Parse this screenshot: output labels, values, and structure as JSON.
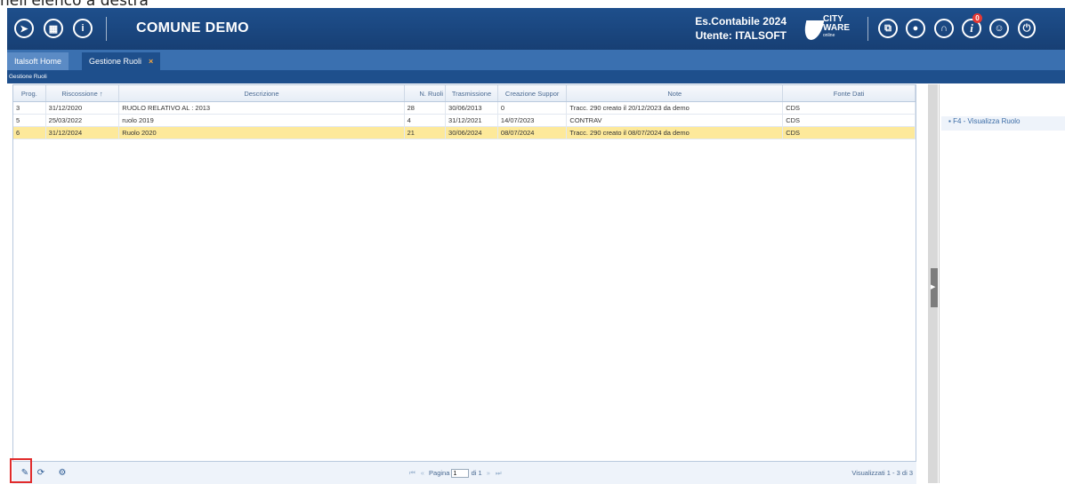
{
  "caption": "nell'elenco a destra",
  "header": {
    "title": "COMUNE DEMO",
    "exercise": "Es.Contabile 2024",
    "user": "Utente: ITALSOFT",
    "brand_line1": "CITY",
    "brand_line2": "WARE",
    "brand_line3": "online",
    "notification_count": "0",
    "left_icons": [
      "compass-icon",
      "grid-menu-icon",
      "info-icon"
    ],
    "right_icons": [
      "windows-icon",
      "chat-icon",
      "headset-icon",
      "info-italic-icon",
      "user-icon",
      "power-icon"
    ]
  },
  "tabs": [
    {
      "label": "Italsoft Home"
    },
    {
      "label": "Gestione Ruoli",
      "close": "×"
    }
  ],
  "section_title": "Gestione Ruoli",
  "grid": {
    "columns": [
      "Prog.",
      "Riscossione",
      "Descrizione",
      "N. Ruoli",
      "Trasmissione",
      "Creazione Suppor",
      "Note",
      "Fonte Dati"
    ],
    "sort_indicator": "↑",
    "rows": [
      {
        "prog": "3",
        "riscossione": "31/12/2020",
        "descrizione": "RUOLO RELATIVO AL : 2013",
        "nruoli": "28",
        "trasmissione": "30/06/2013",
        "creazione": "0",
        "note": "Tracc. 290 creato il 20/12/2023 da demo",
        "fonte": "CDS"
      },
      {
        "prog": "5",
        "riscossione": "25/03/2022",
        "descrizione": "ruolo 2019",
        "nruoli": "4",
        "trasmissione": "31/12/2021",
        "creazione": "14/07/2023",
        "note": "CONTRAV",
        "fonte": "CDS"
      },
      {
        "prog": "6",
        "riscossione": "31/12/2024",
        "descrizione": "Ruolo 2020",
        "nruoli": "21",
        "trasmissione": "30/06/2024",
        "creazione": "08/07/2024",
        "note": "Tracc. 290 creato il 08/07/2024 da demo",
        "fonte": "CDS"
      }
    ],
    "selected_row": 2
  },
  "footer": {
    "page_label": "Pagina",
    "page_value": "1",
    "page_of": "di 1",
    "visualizzati": "Visualizzati 1 - 3 di 3"
  },
  "side_action": "F4 - Visualizza Ruolo"
}
